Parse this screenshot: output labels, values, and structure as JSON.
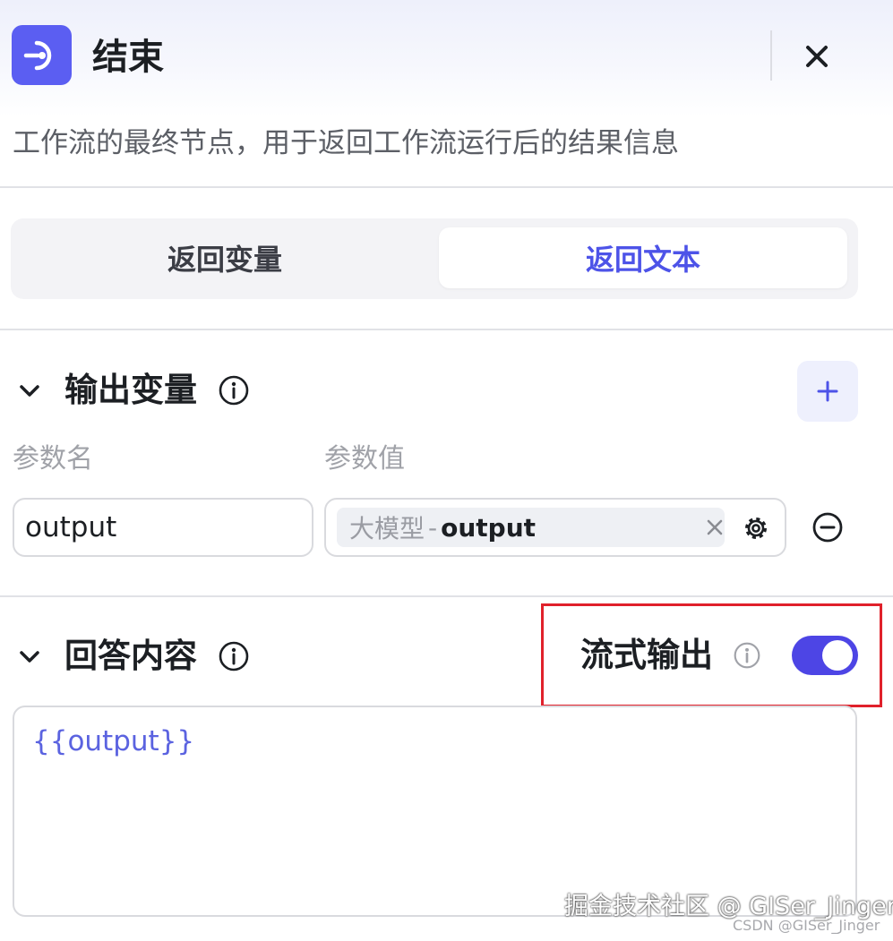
{
  "header": {
    "title": "结束",
    "description": "工作流的最终节点，用于返回工作流运行后的结果信息"
  },
  "segmented": {
    "options": [
      "返回变量",
      "返回文本"
    ],
    "selected": "返回文本"
  },
  "output_section": {
    "title": "输出变量",
    "col_name": "参数名",
    "col_value": "参数值",
    "row": {
      "name": "output",
      "ref_node": "大模型",
      "ref_separator": "-",
      "ref_var": "output"
    }
  },
  "answer_section": {
    "title": "回答内容",
    "stream_label": "流式输出",
    "stream_enabled": true,
    "content": "{{output}}"
  },
  "watermark": {
    "line1": "掘金技术社区 @ GISer_Jinger",
    "line2": "CSDN @GISer_Jinger"
  },
  "colors": {
    "accent": "#4d53e8",
    "toggle_on": "#4d45e5",
    "highlight_border": "#e0212b"
  },
  "icons": {
    "node": "exit-node-icon",
    "close": "close-icon",
    "chevron": "chevron-down-icon",
    "info": "info-icon",
    "add": "plus-icon",
    "clear": "clear-icon",
    "settings": "gear-icon",
    "remove": "minus-circle-icon"
  }
}
